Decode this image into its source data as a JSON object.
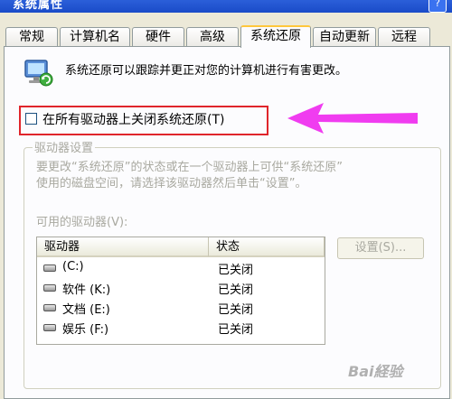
{
  "window": {
    "title": "系统属性",
    "help_glyph": "?"
  },
  "tabs": [
    {
      "label": "常规",
      "active": false
    },
    {
      "label": "计算机名",
      "active": false
    },
    {
      "label": "硬件",
      "active": false
    },
    {
      "label": "高级",
      "active": false
    },
    {
      "label": "系统还原",
      "active": true
    },
    {
      "label": "自动更新",
      "active": false
    },
    {
      "label": "远程",
      "active": false
    }
  ],
  "description": "系统还原可以跟踪并更正对您的计算机进行有害更改。",
  "turn_off": {
    "label": "在所有驱动器上关闭系统还原(T)",
    "checked": false
  },
  "drive_settings": {
    "group_title": "驱动器设置",
    "instructions_line1": "要更改“系统还原”的状态或在一个驱动器上可供“系统还原”",
    "instructions_line2": "使用的磁盘空间，请选择该驱动器然后单击“设置”。",
    "available_label": "可用的驱动器(V):",
    "columns": [
      "驱动器",
      "状态"
    ],
    "drives": [
      {
        "name": "(C:)",
        "status": "已关闭"
      },
      {
        "name": "软件 (K:)",
        "status": "已关闭"
      },
      {
        "name": "文档 (E:)",
        "status": "已关闭"
      },
      {
        "name": "娱乐 (F:)",
        "status": "已关闭"
      }
    ],
    "settings_button": "设置(S)..."
  },
  "watermark": "Bai経验",
  "colors": {
    "highlight_box": "#E0252B",
    "arrow": "#F03CF0",
    "active_tab_top": "#FFC73C"
  },
  "icons": [
    "system-restore-icon",
    "drive-icon",
    "pink-arrow-annotation"
  ]
}
